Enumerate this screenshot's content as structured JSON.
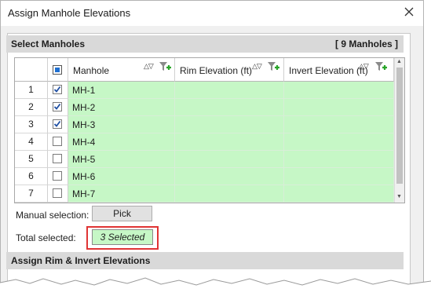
{
  "window": {
    "title": "Assign Manhole Elevations"
  },
  "select_section": {
    "title": "Select Manholes",
    "count": "[ 9 Manholes ]"
  },
  "grid": {
    "columns": [
      "Manhole",
      "Rim Elevation (ft)",
      "Invert Elevation (ft)"
    ],
    "rows": [
      {
        "num": "1",
        "checked": true,
        "manhole": "MH-1",
        "rim": "",
        "invert": ""
      },
      {
        "num": "2",
        "checked": true,
        "manhole": "MH-2",
        "rim": "",
        "invert": ""
      },
      {
        "num": "3",
        "checked": true,
        "manhole": "MH-3",
        "rim": "",
        "invert": ""
      },
      {
        "num": "4",
        "checked": false,
        "manhole": "MH-4",
        "rim": "",
        "invert": ""
      },
      {
        "num": "5",
        "checked": false,
        "manhole": "MH-5",
        "rim": "",
        "invert": ""
      },
      {
        "num": "6",
        "checked": false,
        "manhole": "MH-6",
        "rim": "",
        "invert": ""
      },
      {
        "num": "7",
        "checked": false,
        "manhole": "MH-7",
        "rim": "",
        "invert": ""
      }
    ]
  },
  "manual_selection": {
    "label": "Manual selection:",
    "button": "Pick"
  },
  "total_selected": {
    "label": "Total selected:",
    "value": "3 Selected"
  },
  "assign_section": {
    "title": "Assign Rim & Invert Elevations"
  },
  "colors": {
    "row_green": "#c6f7c6",
    "highlight_red": "#e03434",
    "check_blue": "#1f4fa3"
  }
}
